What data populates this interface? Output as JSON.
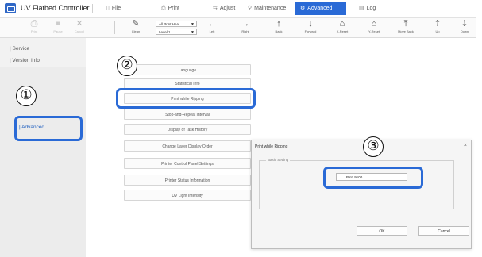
{
  "app": {
    "title": "UV Flatbed Controller"
  },
  "menubar": [
    {
      "label": "File",
      "icon": "file-icon",
      "glyph": "▯"
    },
    {
      "label": "Print",
      "icon": "print-icon",
      "glyph": "⎙"
    },
    {
      "label": "Adjust",
      "icon": "adjust-icon",
      "glyph": "⇆"
    },
    {
      "label": "Maintenance",
      "icon": "maintenance-icon",
      "glyph": "⚲"
    },
    {
      "label": "Advanced",
      "icon": "advanced-icon",
      "glyph": "⚙",
      "active": true
    },
    {
      "label": "Log",
      "icon": "log-icon",
      "glyph": "▤"
    }
  ],
  "toolbar": {
    "buttons": [
      {
        "label": "Print",
        "icon": "print-icon",
        "glyph": "⎙",
        "disabled": true
      },
      {
        "label": "Pause",
        "icon": "pause-icon",
        "glyph": "⏸",
        "disabled": true
      },
      {
        "label": "Cancel",
        "icon": "cancel-icon",
        "glyph": "✕",
        "disabled": true
      },
      {
        "label": "Clean",
        "icon": "clean-icon",
        "glyph": "✎",
        "disabled": false
      },
      {
        "label": "Left",
        "icon": "arrow-left-icon",
        "glyph": "←",
        "disabled": false
      },
      {
        "label": "Right",
        "icon": "arrow-right-icon",
        "glyph": "→",
        "disabled": false
      },
      {
        "label": "Back",
        "icon": "arrow-up-icon",
        "glyph": "↑",
        "disabled": false
      },
      {
        "label": "Forward",
        "icon": "arrow-down-icon",
        "glyph": "↓",
        "disabled": false
      },
      {
        "label": "X-Reset",
        "icon": "x-reset-icon",
        "glyph": "⌂",
        "disabled": false
      },
      {
        "label": "Y-Reset",
        "icon": "y-reset-icon",
        "glyph": "⌂",
        "disabled": false
      },
      {
        "label": "Move Back",
        "icon": "move-back-icon",
        "glyph": "⤒",
        "disabled": false
      },
      {
        "label": "Up",
        "icon": "up-icon",
        "glyph": "⇡",
        "disabled": false
      },
      {
        "label": "Down",
        "icon": "down-icon",
        "glyph": "⇣",
        "disabled": false
      }
    ],
    "head_select": "All Print Hea",
    "level_select": "Level 1"
  },
  "sidebar": {
    "items": [
      {
        "label": "| Service"
      },
      {
        "label": "| Version Info"
      },
      {
        "label": "| Advanced",
        "selected": true
      }
    ]
  },
  "advanced_menu": [
    "Language",
    "Statistical Info",
    "Print while Ripping",
    "Stop-and-Repeat Interval",
    "Display of Task History",
    "Change Layer Display Order",
    "Printer Control Panel Settings",
    "Printer Status Information",
    "UV Light Intensity"
  ],
  "dialog": {
    "title": "Print while Ripping",
    "close": "×",
    "group_label": "Basic Setting",
    "pint_label": "Pint:",
    "pint_value": "9100",
    "ok": "OK",
    "cancel": "Cancel"
  },
  "callouts": [
    "①",
    "②",
    "③"
  ],
  "colors": {
    "accent": "#2a6ad6",
    "highlight": "#1f5fbf"
  }
}
